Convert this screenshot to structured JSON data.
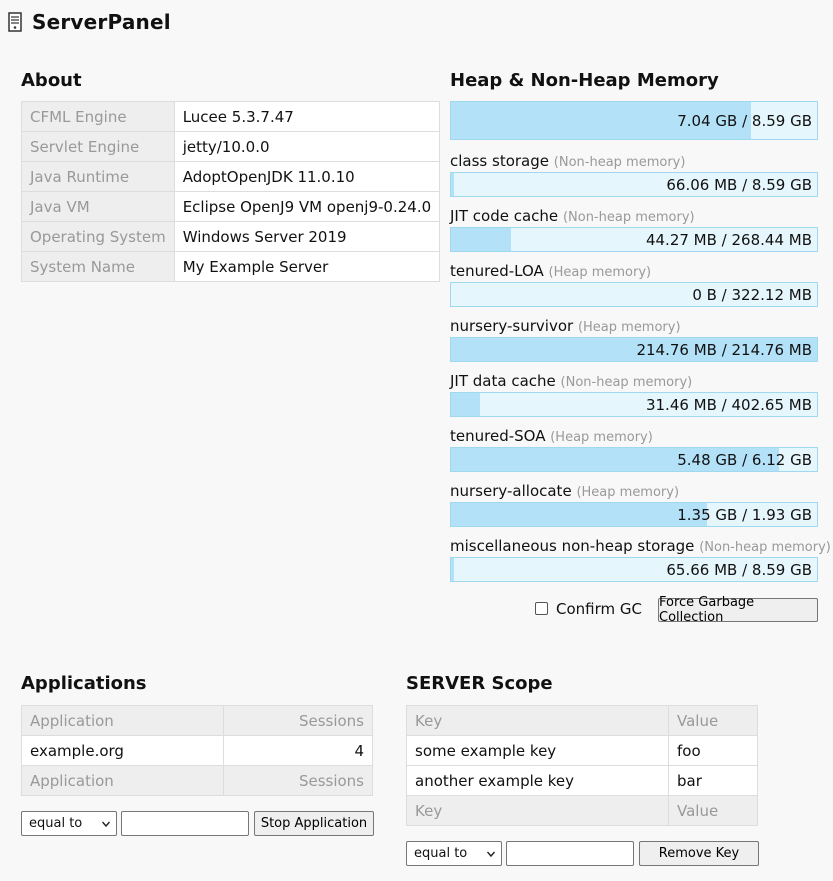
{
  "app": {
    "title": "ServerPanel",
    "logo_icon": "server-icon"
  },
  "about": {
    "title": "About",
    "rows": [
      {
        "key": "CFML Engine",
        "value": "Lucee 5.3.7.47"
      },
      {
        "key": "Servlet Engine",
        "value": "jetty/10.0.0"
      },
      {
        "key": "Java Runtime",
        "value": "AdoptOpenJDK 11.0.10"
      },
      {
        "key": "Java VM",
        "value": "Eclipse OpenJ9 VM openj9-0.24.0"
      },
      {
        "key": "Operating System",
        "value": "Windows Server 2019"
      },
      {
        "key": "System Name",
        "value": "My Example Server"
      }
    ]
  },
  "memory": {
    "title": "Heap & Non-Heap Memory",
    "total": {
      "text": "7.04 GB / 8.59 GB",
      "fraction": 0.82
    },
    "pools": [
      {
        "name": "class storage",
        "kind": "(Non-heap memory)",
        "text": "66.06 MB / 8.59 GB",
        "fraction": 0.008
      },
      {
        "name": "JIT code cache",
        "kind": "(Non-heap memory)",
        "text": "44.27 MB / 268.44 MB",
        "fraction": 0.165
      },
      {
        "name": "tenured-LOA",
        "kind": "(Heap memory)",
        "text": "0 B / 322.12 MB",
        "fraction": 0.0
      },
      {
        "name": "nursery-survivor",
        "kind": "(Heap memory)",
        "text": "214.76 MB / 214.76 MB",
        "fraction": 1.0
      },
      {
        "name": "JIT data cache",
        "kind": "(Non-heap memory)",
        "text": "31.46 MB / 402.65 MB",
        "fraction": 0.078
      },
      {
        "name": "tenured-SOA",
        "kind": "(Heap memory)",
        "text": "5.48 GB / 6.12 GB",
        "fraction": 0.895
      },
      {
        "name": "nursery-allocate",
        "kind": "(Heap memory)",
        "text": "1.35 GB / 1.93 GB",
        "fraction": 0.7
      },
      {
        "name": "miscellaneous non-heap storage",
        "kind": "(Non-heap memory)",
        "text": "65.66 MB / 8.59 GB",
        "fraction": 0.008
      }
    ],
    "confirm_gc_label": "Confirm GC",
    "confirm_gc_checked": false,
    "force_gc_label": "Force Garbage Collection"
  },
  "applications": {
    "title": "Applications",
    "header": {
      "app": "Application",
      "sessions": "Sessions"
    },
    "rows": [
      {
        "app": "example.org",
        "sessions": "4"
      }
    ],
    "filter": {
      "operator": "equal to",
      "value": ""
    },
    "stop_label": "Stop Application"
  },
  "server_scope": {
    "title": "SERVER Scope",
    "header": {
      "key": "Key",
      "value": "Value"
    },
    "rows": [
      {
        "key": "some example key",
        "value": "foo"
      },
      {
        "key": "another example key",
        "value": "bar"
      }
    ],
    "filter": {
      "operator": "equal to",
      "value": ""
    },
    "remove_label": "Remove Key"
  }
}
